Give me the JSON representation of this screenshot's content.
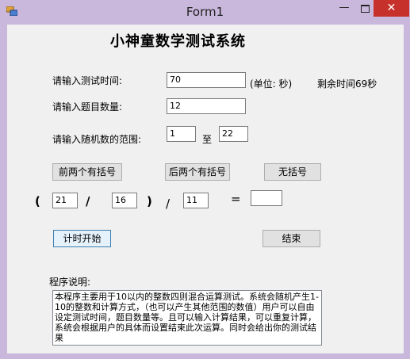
{
  "window": {
    "title": "Form1",
    "minimize": "—",
    "close": "✕"
  },
  "heading": "小神童数学测试系统",
  "time": {
    "label": "请输入测试时间:",
    "value": "70",
    "unit": "(单位: 秒)",
    "remaining": "剩余时间69秒"
  },
  "count": {
    "label": "请输入题目数量:",
    "value": "12"
  },
  "range": {
    "label": "请输入随机数的范围:",
    "min": "1",
    "to": "至",
    "max": "22"
  },
  "buttons": {
    "front_paren": "前两个有括号",
    "back_paren": "后两个有括号",
    "no_paren": "无括号",
    "start": "计时开始",
    "end": "结束"
  },
  "expression": {
    "open": "(",
    "a": "21",
    "op1": "/",
    "b": "16",
    "close": ")",
    "op2": "/",
    "c": "11",
    "eq": "=",
    "answer": ""
  },
  "description": {
    "label": "程序说明:",
    "text": "本程序主要用于10以内的整数四则混合运算测试。系统会随机产生1-10的整数和计算方式，（也可以产生其他范围的数值）用户可以自由设定测试时间，题目数量等。且可以输入计算结果，可以重复计算，系统会根据用户的具体而设置结束此次运算。同时会给出你的测试结果"
  }
}
